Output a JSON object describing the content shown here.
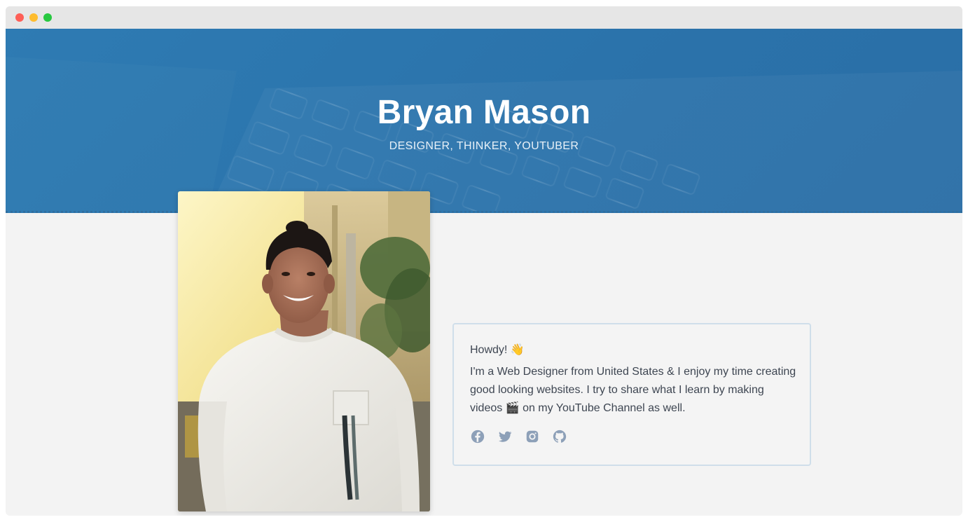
{
  "window": {
    "controls": [
      "close",
      "minimize",
      "maximize"
    ]
  },
  "hero": {
    "name": "Bryan Mason",
    "tagline": "DESIGNER, THINKER, YOUTUBER"
  },
  "intro": {
    "greeting": "Howdy! 👋",
    "bio": "I'm a Web Designer from United States & I enjoy my time creating good looking websites. I try to share what I learn by making videos 🎬 on my YouTube Channel as well."
  },
  "socials": [
    {
      "name": "facebook",
      "icon": "facebook-icon"
    },
    {
      "name": "twitter",
      "icon": "twitter-icon"
    },
    {
      "name": "instagram",
      "icon": "instagram-icon"
    },
    {
      "name": "github",
      "icon": "github-icon"
    }
  ],
  "colors": {
    "hero": "#2b73ab",
    "background": "#f3f3f3",
    "card_border": "#cfdeea",
    "icon": "#8da0b8",
    "text": "#3e4652"
  }
}
